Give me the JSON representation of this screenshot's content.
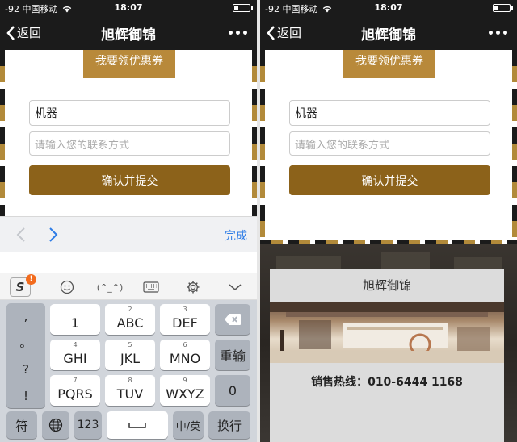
{
  "status_bar": {
    "carrier": "-92 中国移动",
    "time": "18:07"
  },
  "nav": {
    "back_label": "返回",
    "title": "旭辉御锦"
  },
  "form": {
    "coupon_button": "我要领优惠券",
    "name_value": "机器",
    "contact_placeholder": "请输入您的联系方式",
    "submit_button": "确认并提交"
  },
  "accessory": {
    "done_label": "完成"
  },
  "ime_toolbar": {
    "logo": "S",
    "badge": "!",
    "emoticon": "(^_^)"
  },
  "keyboard": {
    "punctuation": [
      ",",
      "。",
      "?",
      "!"
    ],
    "keys": [
      {
        "sub": "",
        "main": "1"
      },
      {
        "sub": "2",
        "main": "ABC"
      },
      {
        "sub": "3",
        "main": "DEF"
      },
      {
        "sub": "4",
        "main": "GHI"
      },
      {
        "sub": "5",
        "main": "JKL"
      },
      {
        "sub": "6",
        "main": "MNO"
      },
      {
        "sub": "7",
        "main": "PQRS"
      },
      {
        "sub": "8",
        "main": "TUV"
      },
      {
        "sub": "9",
        "main": "WXYZ"
      }
    ],
    "reenter": "重输",
    "zero": "0",
    "symbol": "符",
    "num": "123",
    "space": "␣",
    "lang": "中/英",
    "enter": "换行"
  },
  "popup": {
    "title": "旭辉御锦",
    "phone": "销售热线：010-6444 1168"
  },
  "colors": {
    "gold": "#b8893a",
    "submit": "#8c621a",
    "bar": "#1b1b1b",
    "link_blue": "#2d7ce6"
  }
}
